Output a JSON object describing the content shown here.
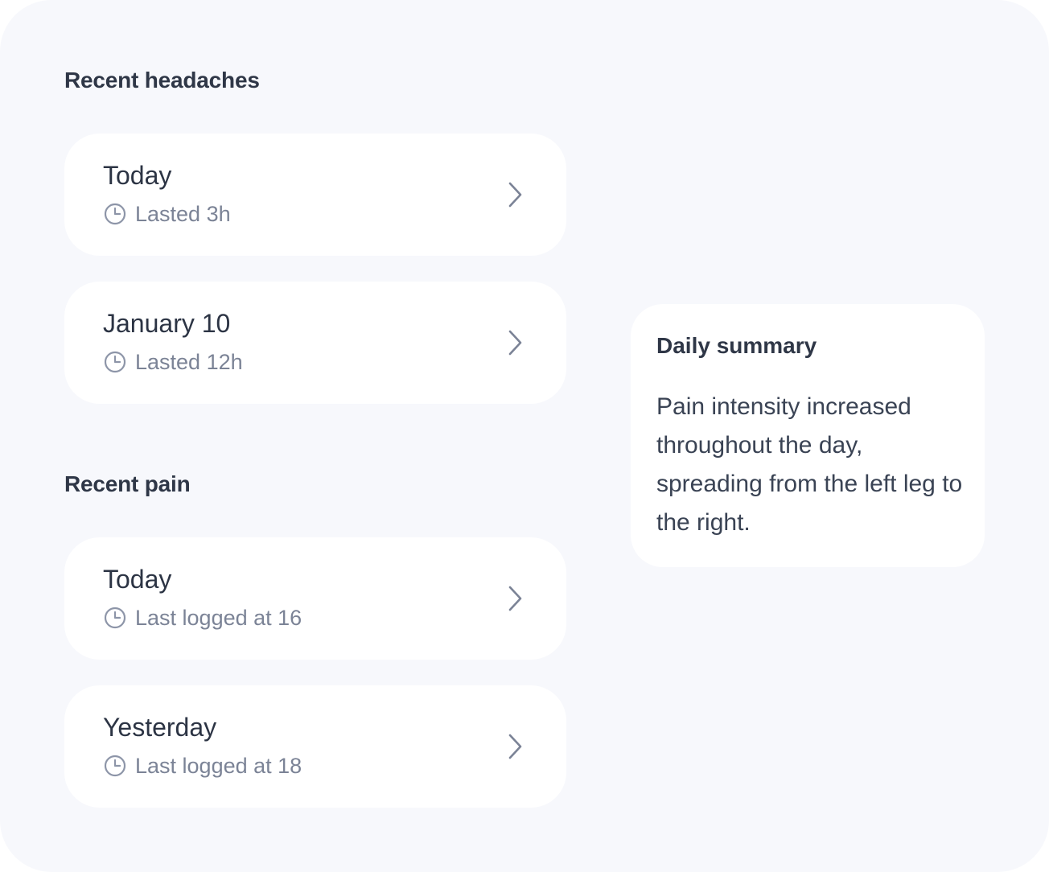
{
  "sections": {
    "headaches": {
      "title": "Recent headaches",
      "items": [
        {
          "title": "Today",
          "meta": "Lasted 3h"
        },
        {
          "title": "January 10",
          "meta": "Lasted 12h"
        }
      ]
    },
    "pain": {
      "title": "Recent pain",
      "items": [
        {
          "title": "Today",
          "meta": "Last logged at 16"
        },
        {
          "title": "Yesterday",
          "meta": "Last logged at 18"
        }
      ]
    }
  },
  "summary": {
    "title": "Daily summary",
    "body": "Pain intensity increased throughout the day, spreading from the left leg to the right."
  },
  "icons": {
    "meta": "clock-icon",
    "item_action": "chevron-right-icon"
  },
  "colors": {
    "background": "#f7f8fc",
    "card": "#ffffff",
    "heading": "#2f3747",
    "muted": "#7b8396",
    "icon": "#8d95a8"
  }
}
